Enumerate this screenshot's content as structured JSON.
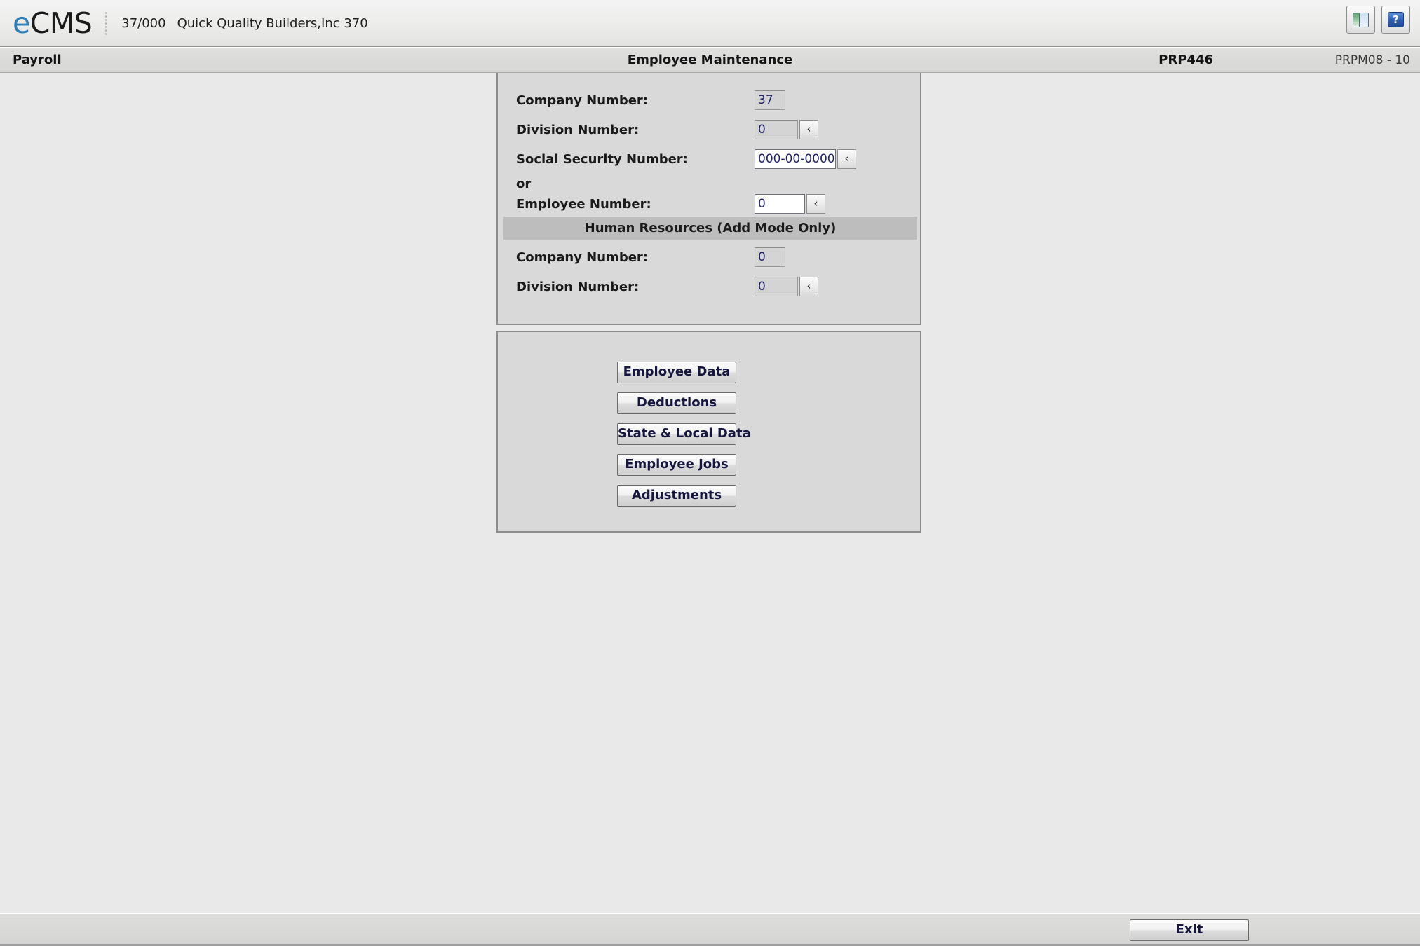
{
  "brand": {
    "logo_prefix": "e",
    "logo_main": "CMS",
    "company_code": "37/000",
    "company_name": "Quick Quality Builders,Inc 370",
    "panels_icon": "panels-icon",
    "help_icon": "help-icon"
  },
  "module": {
    "name": "Payroll",
    "title": "Employee Maintenance",
    "program_id": "PRP446",
    "version": "PRPM08 - 10"
  },
  "criteria": {
    "fields": [
      {
        "label": "Company Number:",
        "value": "37",
        "editable": false,
        "prompt": false
      },
      {
        "label": "Division Number:",
        "value": "0",
        "editable": false,
        "prompt": true
      },
      {
        "label": "Social Security Number:",
        "value": "000-00-0000",
        "editable": true,
        "prompt": true
      }
    ],
    "or_label": "or",
    "employee_field": {
      "label": "Employee Number:",
      "value": "0",
      "editable": true,
      "prompt": true
    }
  },
  "hr_section": {
    "heading": "Human Resources (Add Mode Only)",
    "fields": [
      {
        "label": "Company Number:",
        "value": "0",
        "editable": false,
        "prompt": false
      },
      {
        "label": "Division Number:",
        "value": "0",
        "editable": false,
        "prompt": true
      }
    ]
  },
  "actions": {
    "buttons": [
      {
        "label": "Employee Data"
      },
      {
        "label": "Deductions"
      },
      {
        "label": "State & Local Data"
      },
      {
        "label": "Employee Jobs"
      },
      {
        "label": "Adjustments"
      }
    ]
  },
  "footer": {
    "exit_label": "Exit"
  },
  "prompt_glyph": "‹",
  "colors": {
    "accent_blue": "#2d7fb8",
    "field_text": "#21216b",
    "panel_bg": "#d9d9d9",
    "app_bg": "#e9e9e9",
    "section_head_bg": "#bdbdbd"
  }
}
